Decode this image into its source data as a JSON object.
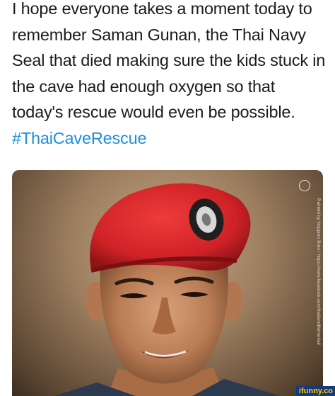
{
  "post": {
    "text": "I hope everyone takes a moment today to remember Saman Gunan, the Thai Navy Seal that died making sure the kids stuck in the cave had enough oxygen so that today's rescue would even be possible. ",
    "hashtag": "#ThaiCaveRescue"
  },
  "photo": {
    "credit": "Painted by Nopporn Bren / https://www.facebook.com/thailandMemorial/",
    "beret_color": "#d8262c"
  },
  "watermark": {
    "text": "ifunny.co"
  },
  "colors": {
    "text": "#1b1b1b",
    "hashtag": "#1d8fe0",
    "watermark_bg": "#163a7a",
    "watermark_text": "#ffcc00"
  }
}
